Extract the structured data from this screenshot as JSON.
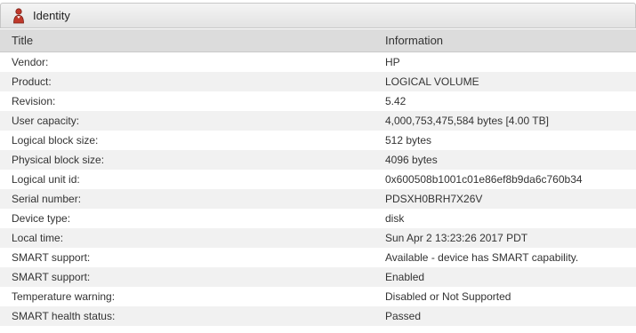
{
  "panel": {
    "title": "Identity",
    "icon": "person-icon"
  },
  "table": {
    "headers": {
      "title": "Title",
      "information": "Information"
    },
    "rows": [
      {
        "title": "Vendor:",
        "info": "HP"
      },
      {
        "title": "Product:",
        "info": "LOGICAL VOLUME"
      },
      {
        "title": "Revision:",
        "info": "5.42"
      },
      {
        "title": "User capacity:",
        "info": "4,000,753,475,584 bytes [4.00 TB]"
      },
      {
        "title": "Logical block size:",
        "info": "512 bytes"
      },
      {
        "title": "Physical block size:",
        "info": "4096 bytes"
      },
      {
        "title": "Logical unit id:",
        "info": "0x600508b1001c01e86ef8b9da6c760b34"
      },
      {
        "title": "Serial number:",
        "info": "PDSXH0BRH7X26V"
      },
      {
        "title": "Device type:",
        "info": "disk"
      },
      {
        "title": "Local time:",
        "info": "Sun Apr 2 13:23:26 2017 PDT"
      },
      {
        "title": "SMART support:",
        "info": "Available - device has SMART capability."
      },
      {
        "title": "SMART support:",
        "info": "Enabled"
      },
      {
        "title": "Temperature warning:",
        "info": "Disabled or Not Supported"
      },
      {
        "title": "SMART health status:",
        "info": "Passed"
      }
    ]
  },
  "colors": {
    "passed": "#3c7a1d",
    "icon_red": "#c0392b"
  }
}
